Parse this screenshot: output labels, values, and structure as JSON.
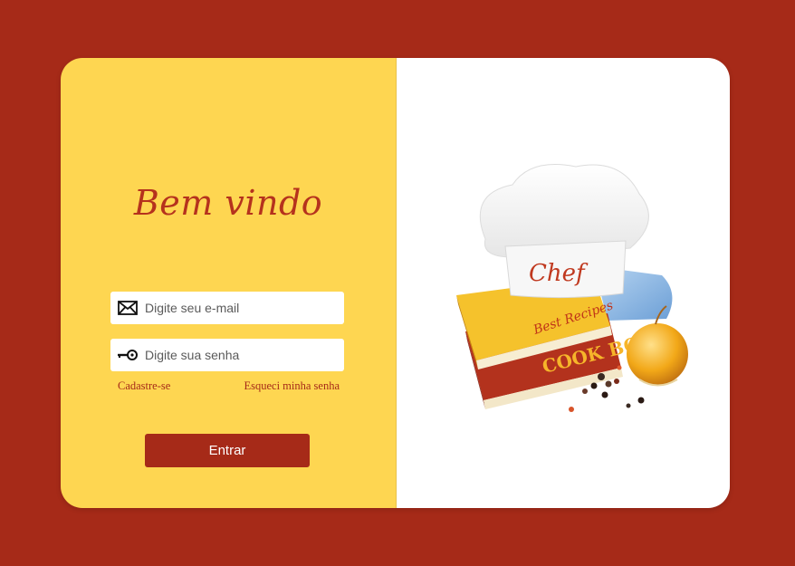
{
  "welcome": {
    "title": "Bem vindo"
  },
  "form": {
    "email_placeholder": "Digite seu e-mail",
    "password_placeholder": "Digite sua senha",
    "signup_label": "Cadastre-se",
    "forgot_label": "Esqueci minha senha",
    "submit_label": "Entrar"
  },
  "icons": {
    "email": "envelope-icon",
    "password": "key-icon"
  },
  "illustration": {
    "hat_text": "Chef",
    "book1_text": "Best Recipes",
    "book2_text": "COOK BOOK"
  },
  "colors": {
    "background": "#a62a18",
    "panel": "#fed651",
    "accent": "#b5321d"
  }
}
